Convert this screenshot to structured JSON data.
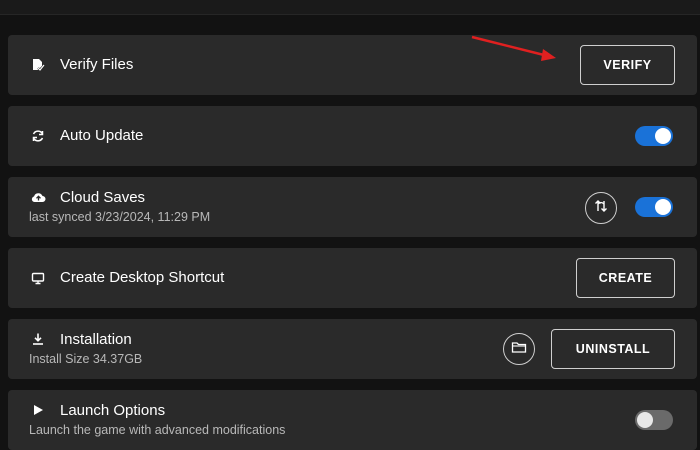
{
  "settings": {
    "verify": {
      "title": "Verify Files",
      "button": "VERIFY",
      "icon": "file-check-icon"
    },
    "auto_update": {
      "title": "Auto Update",
      "enabled": true,
      "icon": "refresh-icon"
    },
    "cloud_saves": {
      "title": "Cloud Saves",
      "subtitle": "last synced 3/23/2024, 11:29 PM",
      "enabled": true,
      "icon": "cloud-upload-icon",
      "sync_icon": "sync-arrows-icon"
    },
    "shortcut": {
      "title": "Create Desktop Shortcut",
      "button": "CREATE",
      "icon": "monitor-icon"
    },
    "installation": {
      "title": "Installation",
      "subtitle": "Install Size 34.37GB",
      "button": "UNINSTALL",
      "icon": "download-icon",
      "folder_icon": "folder-icon"
    },
    "launch_options": {
      "title": "Launch Options",
      "subtitle": "Launch the game with advanced modifications",
      "enabled": false,
      "icon": "play-icon"
    }
  },
  "colors": {
    "background": "#121212",
    "row": "#2a2a2a",
    "toggle_on": "#1a72d8",
    "annotation_arrow": "#e02020"
  }
}
